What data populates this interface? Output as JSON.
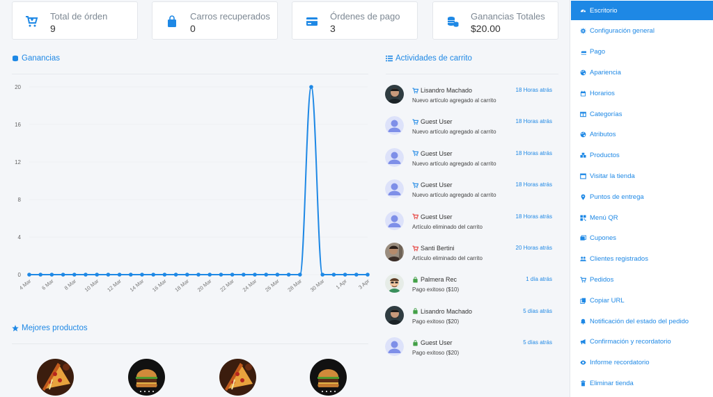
{
  "stats": [
    {
      "label": "Total de órden",
      "value": "9",
      "icon": "cart-plus-icon"
    },
    {
      "label": "Carros recuperados",
      "value": "0",
      "icon": "shopping-bag-icon"
    },
    {
      "label": "Órdenes de pago",
      "value": "3",
      "icon": "credit-card-icon"
    },
    {
      "label": "Ganancias Totales",
      "value": "$20.00",
      "icon": "coins-icon"
    }
  ],
  "earnings": {
    "title": "Ganancias"
  },
  "activities": {
    "title": "Actividades de carrito",
    "items": [
      {
        "name": "Lisandro Machado",
        "desc": "Nuevo artículo agregado al carrito",
        "time": "18 Horas atrás",
        "status": "added",
        "avatar": "photo-man"
      },
      {
        "name": "Guest User",
        "desc": "Nuevo artículo agregado al carrito",
        "time": "18 Horas atrás",
        "status": "added",
        "avatar": "guest"
      },
      {
        "name": "Guest User",
        "desc": "Nuevo artículo agregado al carrito",
        "time": "18 Horas atrás",
        "status": "added",
        "avatar": "guest"
      },
      {
        "name": "Guest User",
        "desc": "Nuevo artículo agregado al carrito",
        "time": "18 Horas atrás",
        "status": "added",
        "avatar": "guest"
      },
      {
        "name": "Guest User",
        "desc": "Artículo eliminado del carrito",
        "time": "18 Horas atrás",
        "status": "removed",
        "avatar": "guest"
      },
      {
        "name": "Santi Bertini",
        "desc": "Artículo eliminado del carrito",
        "time": "20 Horas atrás",
        "status": "removed",
        "avatar": "photo-man2"
      },
      {
        "name": "Palmera Rec",
        "desc": "Pago exitoso ($10)",
        "time": "1 día atrás",
        "status": "paid",
        "avatar": "cartoon"
      },
      {
        "name": "Lisandro Machado",
        "desc": "Pago exitoso ($20)",
        "time": "5 días atrás",
        "status": "paid",
        "avatar": "photo-man"
      },
      {
        "name": "Guest User",
        "desc": "Pago exitoso ($20)",
        "time": "5 días atrás",
        "status": "paid",
        "avatar": "guest"
      }
    ]
  },
  "best_products": {
    "title": "Mejores productos",
    "items": [
      {
        "image": "pizza-image"
      },
      {
        "image": "burger-image"
      },
      {
        "image": "pizza-image"
      },
      {
        "image": "burger-image"
      }
    ]
  },
  "sidebar": {
    "items": [
      {
        "label": "Escritorio",
        "icon": "dashboard-icon",
        "active": true
      },
      {
        "label": "Configuración general",
        "icon": "gear-icon"
      },
      {
        "label": "Pago",
        "icon": "credit-card-icon"
      },
      {
        "label": "Apariencia",
        "icon": "palette-icon"
      },
      {
        "label": "Horarios",
        "icon": "calendar-icon"
      },
      {
        "label": "Categorías",
        "icon": "columns-icon"
      },
      {
        "label": "Atributos",
        "icon": "palette-icon"
      },
      {
        "label": "Productos",
        "icon": "cubes-icon"
      },
      {
        "label": "Visitar la tienda",
        "icon": "window-icon"
      },
      {
        "label": "Puntos de entrega",
        "icon": "map-marker-icon"
      },
      {
        "label": "Menú QR",
        "icon": "qrcode-icon"
      },
      {
        "label": "Cupones",
        "icon": "coupon-icon"
      },
      {
        "label": "Clientes registrados",
        "icon": "users-icon"
      },
      {
        "label": "Pedidos",
        "icon": "cart-icon"
      },
      {
        "label": "Copiar URL",
        "icon": "copy-icon"
      },
      {
        "label": "Notificación del estado del pedido",
        "icon": "bell-icon"
      },
      {
        "label": "Confirmación y recordatorio",
        "icon": "bullhorn-icon"
      },
      {
        "label": "Informe recordatorio",
        "icon": "eye-icon"
      },
      {
        "label": "Eliminar tienda",
        "icon": "trash-icon"
      }
    ]
  },
  "colors": {
    "accent": "#1e88e5",
    "removed": "#e53935",
    "paid": "#43a047"
  },
  "chart_data": {
    "type": "line",
    "x": [
      "4 Mar",
      "5 Mar",
      "6 Mar",
      "7 Mar",
      "8 Mar",
      "9 Mar",
      "10 Mar",
      "11 Mar",
      "12 Mar",
      "13 Mar",
      "14 Mar",
      "15 Mar",
      "16 Mar",
      "17 Mar",
      "18 Mar",
      "19 Mar",
      "20 Mar",
      "21 Mar",
      "22 Mar",
      "23 Mar",
      "24 Mar",
      "25 Mar",
      "26 Mar",
      "27 Mar",
      "28 Mar",
      "29 Mar",
      "30 Mar",
      "31 Mar",
      "1 Apr",
      "2 Apr",
      "3 Apr"
    ],
    "tick_labels": [
      "4 Mar",
      "6 Mar",
      "8 Mar",
      "10 Mar",
      "12 Mar",
      "14 Mar",
      "16 Mar",
      "18 Mar",
      "20 Mar",
      "22 Mar",
      "24 Mar",
      "26 Mar",
      "28 Mar",
      "30 Mar",
      "1 Apr",
      "3 Apr"
    ],
    "series": [
      {
        "values": [
          0,
          0,
          0,
          0,
          0,
          0,
          0,
          0,
          0,
          0,
          0,
          0,
          0,
          0,
          0,
          0,
          0,
          0,
          0,
          0,
          0,
          0,
          0,
          0,
          0,
          20,
          0,
          0,
          0,
          0,
          0
        ]
      }
    ],
    "yticks": [
      0,
      4,
      8,
      12,
      16,
      20
    ],
    "ylim": [
      0,
      20
    ],
    "grid": true
  }
}
